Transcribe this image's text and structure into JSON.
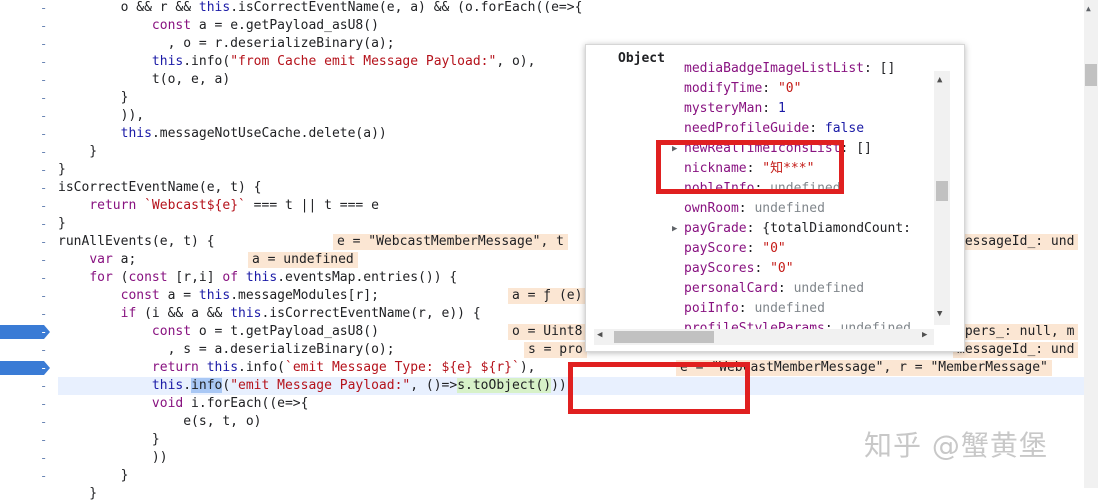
{
  "gutter": {
    "marks": [
      "-",
      "-",
      "-",
      "-",
      "-",
      "-",
      "-",
      "-",
      "-",
      "-",
      "-",
      "-",
      "-",
      "-",
      "-",
      "-",
      "-",
      "-",
      "-",
      "-",
      "-",
      "-",
      "-",
      "-",
      "-",
      "-",
      "-"
    ],
    "breakpoint_rows": [
      18,
      20
    ]
  },
  "code": {
    "lines": [
      {
        "text": "        o && r && this.isCorrectEventName(e, a) && (o.forEach((e=>{"
      },
      {
        "text": "            const a = e.getPayload_asU8()"
      },
      {
        "text": "              , o = r.deserializeBinary(a);"
      },
      {
        "text": "            this.info(\"from Cache emit Message Payload:\", o),"
      },
      {
        "text": "            t(o, e, a)"
      },
      {
        "text": "        }"
      },
      {
        "text": "        )),"
      },
      {
        "text": "        this.messageNotUseCache.delete(a))"
      },
      {
        "text": "    }"
      },
      {
        "text": "}"
      },
      {
        "text": "isCorrectEventName(e, t) {"
      },
      {
        "text": "    return `Webcast${e}` === t || t === e"
      },
      {
        "text": "}"
      },
      {
        "text": "runAllEvents(e, t) {"
      },
      {
        "text": "    var a;"
      },
      {
        "text": "    for (const [r,i] of this.eventsMap.entries()) {"
      },
      {
        "text": "        const a = this.messageModules[r];"
      },
      {
        "text": "        if (i && a && this.isCorrectEventName(r, e)) {"
      },
      {
        "text": "            const o = t.getPayload_asU8()"
      },
      {
        "text": "              , s = a.deserializeBinary(o);"
      },
      {
        "text": "            return this.info(`emit Message Type: ${e} ${r}`),"
      },
      {
        "text": "            this.info(\"emit Message Payload:\", ()=>s.toObject())),"
      },
      {
        "text": "            void i.forEach((e=>{"
      },
      {
        "text": "                e(s, t, o)"
      },
      {
        "text": "            }"
      },
      {
        "text": "            ))"
      },
      {
        "text": "        }"
      },
      {
        "text": "    }"
      }
    ],
    "inline_values": [
      {
        "row": 13,
        "text": "e = \"WebcastMemberMessage\", t"
      },
      {
        "row": 13,
        "text": "messageId_: und"
      },
      {
        "row": 14,
        "text": "a = undefined"
      },
      {
        "row": 16,
        "text": "a = ƒ (e)"
      },
      {
        "row": 18,
        "text": "o = Uint8"
      },
      {
        "row": 18,
        "text": "ppers_: null, m"
      },
      {
        "row": 19,
        "text": "s = pro"
      },
      {
        "row": 19,
        "text": "messageId_: und"
      },
      {
        "row": 20,
        "text": "e = \"WebcastMemberMessage\", r = \"MemberMessage\""
      }
    ]
  },
  "popup": {
    "title": "Object",
    "rows": [
      {
        "key": "mediaBadgeImageListList",
        "sep": ": ",
        "value": "[]",
        "kind": "plain",
        "expandable": false,
        "partial": true
      },
      {
        "key": "modifyTime",
        "sep": ": ",
        "value": "\"0\"",
        "kind": "str",
        "expandable": false
      },
      {
        "key": "mysteryMan",
        "sep": ": ",
        "value": "1",
        "kind": "num",
        "expandable": false
      },
      {
        "key": "needProfileGuide",
        "sep": ": ",
        "value": "false",
        "kind": "bool",
        "expandable": false
      },
      {
        "key": "newRealTimeIconsList",
        "sep": ": ",
        "value": "[]",
        "kind": "plain",
        "expandable": true
      },
      {
        "key": "nickname",
        "sep": ": ",
        "value": "\"知***\"",
        "kind": "str",
        "expandable": false
      },
      {
        "key": "nobleInfo",
        "sep": ": ",
        "value": "undefined",
        "kind": "und",
        "expandable": false
      },
      {
        "key": "ownRoom",
        "sep": ": ",
        "value": "undefined",
        "kind": "und",
        "expandable": false
      },
      {
        "key": "payGrade",
        "sep": ": ",
        "value": "{totalDiamondCount:",
        "kind": "plain",
        "expandable": true
      },
      {
        "key": "payScore",
        "sep": ": ",
        "value": "\"0\"",
        "kind": "str",
        "expandable": false
      },
      {
        "key": "payScores",
        "sep": ": ",
        "value": "\"0\"",
        "kind": "str",
        "expandable": false
      },
      {
        "key": "personalCard",
        "sep": ": ",
        "value": "undefined",
        "kind": "und",
        "expandable": false
      },
      {
        "key": "poiInfo",
        "sep": ": ",
        "value": "undefined",
        "kind": "und",
        "expandable": false
      },
      {
        "key": "profileStyleParams",
        "sep": ": ",
        "value": "undefined",
        "kind": "und",
        "expandable": false
      }
    ]
  },
  "watermark": {
    "text": "知乎 @蟹黄堡"
  },
  "colors": {
    "breakpoint": "#3a7bd5",
    "annotation_red": "#e02020",
    "inline_value_bg": "#fbe6d3",
    "current_line_bg": "#e8f0fe"
  }
}
